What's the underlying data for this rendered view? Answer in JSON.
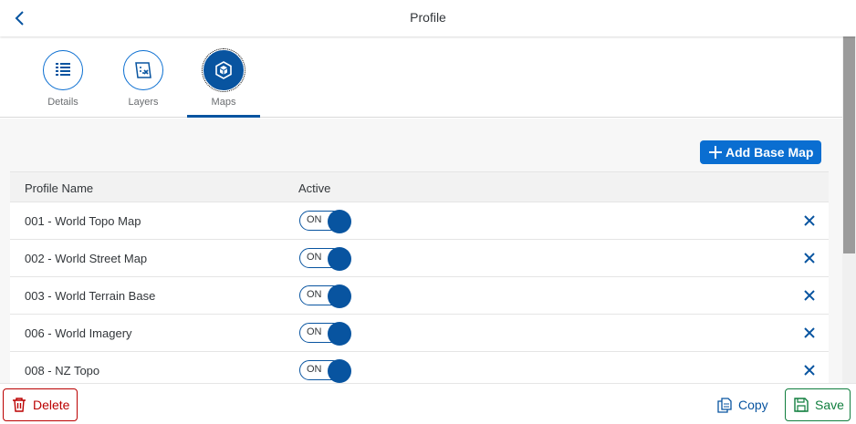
{
  "header": {
    "title": "Profile",
    "back_icon": "chevron-left-icon"
  },
  "tabs": [
    {
      "label": "Details",
      "icon": "list-icon",
      "selected": false
    },
    {
      "label": "Layers",
      "icon": "map-layers-icon",
      "selected": false
    },
    {
      "label": "Maps",
      "icon": "cube-icon",
      "selected": true
    }
  ],
  "toolbar": {
    "add_label": "Add Base Map"
  },
  "table": {
    "columns": [
      "Profile Name",
      "Active"
    ],
    "rows": [
      {
        "name": "001 - World Topo Map",
        "active": "ON"
      },
      {
        "name": "002 - World Street Map",
        "active": "ON"
      },
      {
        "name": "003 - World Terrain Base",
        "active": "ON"
      },
      {
        "name": "006 - World Imagery",
        "active": "ON"
      },
      {
        "name": "008 - NZ Topo",
        "active": "ON"
      }
    ]
  },
  "footer": {
    "delete_label": "Delete",
    "copy_label": "Copy",
    "save_label": "Save"
  },
  "colors": {
    "accent": "#0854a0",
    "button_blue": "#0a6ed1",
    "delete_red": "#bb0000",
    "save_green": "#107e3e"
  }
}
